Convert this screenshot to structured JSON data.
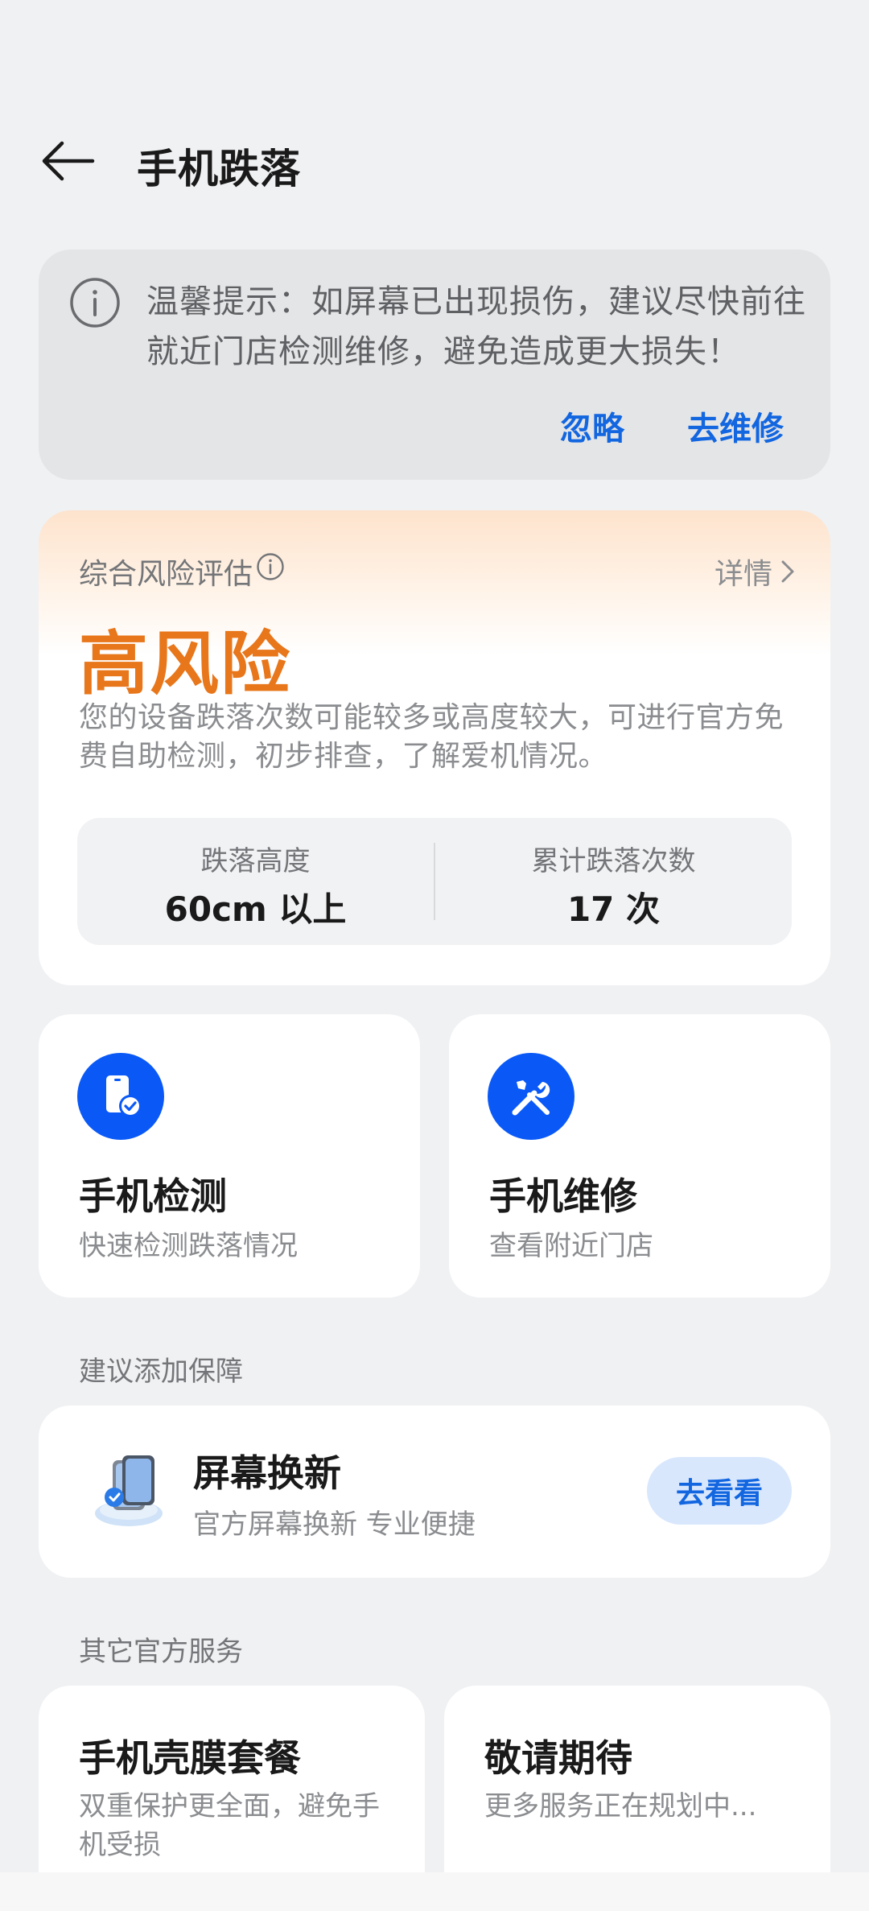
{
  "header": {
    "title": "手机跌落"
  },
  "tip": {
    "text": "温馨提示：如屏幕已出现损伤，建议尽快前往就近门店检测维修，避免造成更大损失！",
    "ignore_label": "忽略",
    "repair_label": "去维修"
  },
  "risk": {
    "label": "综合风险评估",
    "detail_label": "详情",
    "level": "高风险",
    "level_color": "#e8761a",
    "description": "您的设备跌落次数可能较多或高度较大，可进行官方免费自助检测，初步排查，了解爱机情况。",
    "stats": [
      {
        "label": "跌落高度",
        "value": "60cm 以上"
      },
      {
        "label": "累计跌落次数",
        "value": "17 次"
      }
    ]
  },
  "actions": [
    {
      "title": "手机检测",
      "subtitle": "快速检测跌落情况",
      "icon": "phone-check-icon"
    },
    {
      "title": "手机维修",
      "subtitle": "查看附近门店",
      "icon": "wrench-screwdriver-icon"
    }
  ],
  "recommend": {
    "section_title": "建议添加保障",
    "title": "屏幕换新",
    "subtitle": "官方屏幕换新 专业便捷",
    "button_label": "去看看",
    "icon": "screen-replacement-icon"
  },
  "services": {
    "section_title": "其它官方服务",
    "items": [
      {
        "title": "手机壳膜套餐",
        "subtitle": "双重保护更全面，避免手机受损"
      },
      {
        "title": "敬请期待",
        "subtitle": "更多服务正在规划中..."
      }
    ]
  },
  "colors": {
    "accent": "#1266e0",
    "icon_bg": "#0a59f7",
    "background": "#f0f1f3"
  }
}
